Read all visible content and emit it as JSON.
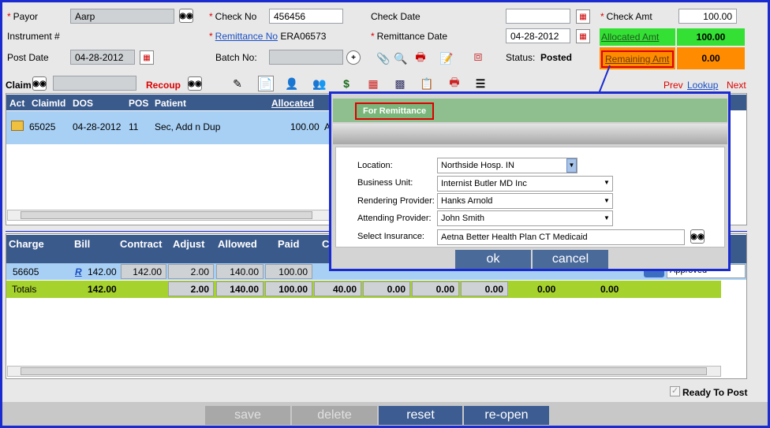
{
  "header": {
    "payor_label": "Payor",
    "payor_value": "Aarp",
    "instrument_label": "Instrument #",
    "post_date_label": "Post Date",
    "post_date_value": "04-28-2012",
    "check_no_label": "Check No",
    "check_no_value": "456456",
    "remittance_no_label": "Remittance No",
    "remittance_no_value": "ERA06573",
    "batch_no_label": "Batch No:",
    "check_date_label": "Check Date",
    "check_date_value": "",
    "remittance_date_label": "Remittance Date",
    "remittance_date_value": "04-28-2012",
    "status_label": "Status:",
    "status_value": "Posted",
    "check_amt_label": "Check Amt",
    "check_amt_value": "100.00",
    "allocated_amt_label": "Allocated Amt",
    "allocated_amt_value": "100.00",
    "remaining_amt_label": "Remaining Amt",
    "remaining_amt_value": "0.00"
  },
  "claim_bar": {
    "claim_label": "Claim",
    "recoup_label": "Recoup",
    "prev": "Prev",
    "lookup": "Lookup",
    "next": "Next"
  },
  "claims_table": {
    "headers": [
      "Act",
      "ClaimId",
      "DOS",
      "POS",
      "Patient",
      "Allocated"
    ],
    "row": {
      "claim_id": "65025",
      "dos": "04-28-2012",
      "pos": "11",
      "patient": "Sec, Add n Dup",
      "allocated": "100.00",
      "trail": "A"
    }
  },
  "charges_table": {
    "headers": [
      "Charge",
      "Bill",
      "Contract",
      "Adjust",
      "Allowed",
      "Paid",
      "C"
    ],
    "row": {
      "charge": "56605",
      "bill_link": "R",
      "bill": "142.00",
      "contract": "142.00",
      "adjust": "2.00",
      "allowed": "140.00",
      "paid": "100.00",
      "status": "Approved"
    },
    "totals": {
      "label": "Totals",
      "bill": "142.00",
      "adjust": "2.00",
      "allowed": "140.00",
      "paid": "100.00",
      "c1": "40.00",
      "c2": "0.00",
      "c3": "0.00",
      "c4": "0.00",
      "c5": "0.00",
      "c6": "0.00"
    }
  },
  "ready_to_post": "Ready To Post",
  "footer_buttons": {
    "save": "save",
    "delete": "delete",
    "reset": "reset",
    "reopen": "re-open"
  },
  "dialog": {
    "title": "For Remittance",
    "location_label": "Location:",
    "location_value": "Northside Hosp. IN",
    "business_unit_label": "Business Unit:",
    "business_unit_value": "Internist Butler MD Inc",
    "rendering_label": "Rendering Provider:",
    "rendering_value": "Hanks Arnold",
    "attending_label": "Attending Provider:",
    "attending_value": "John Smith",
    "insurance_label": "Select Insurance:",
    "insurance_value": "Aetna Better Health Plan CT Medicaid",
    "ok": "ok",
    "cancel": "cancel"
  },
  "colors": {
    "frame": "#1a2bd0",
    "grid_header": "#3a5a8c",
    "selected_row": "#a8d0f5",
    "totals": "#a6d22e",
    "allocated_bg": "#33e033",
    "remaining_bg": "#ff8c00",
    "dialog_title": "#8fbf8f",
    "button_blue": "#3d5d92"
  }
}
